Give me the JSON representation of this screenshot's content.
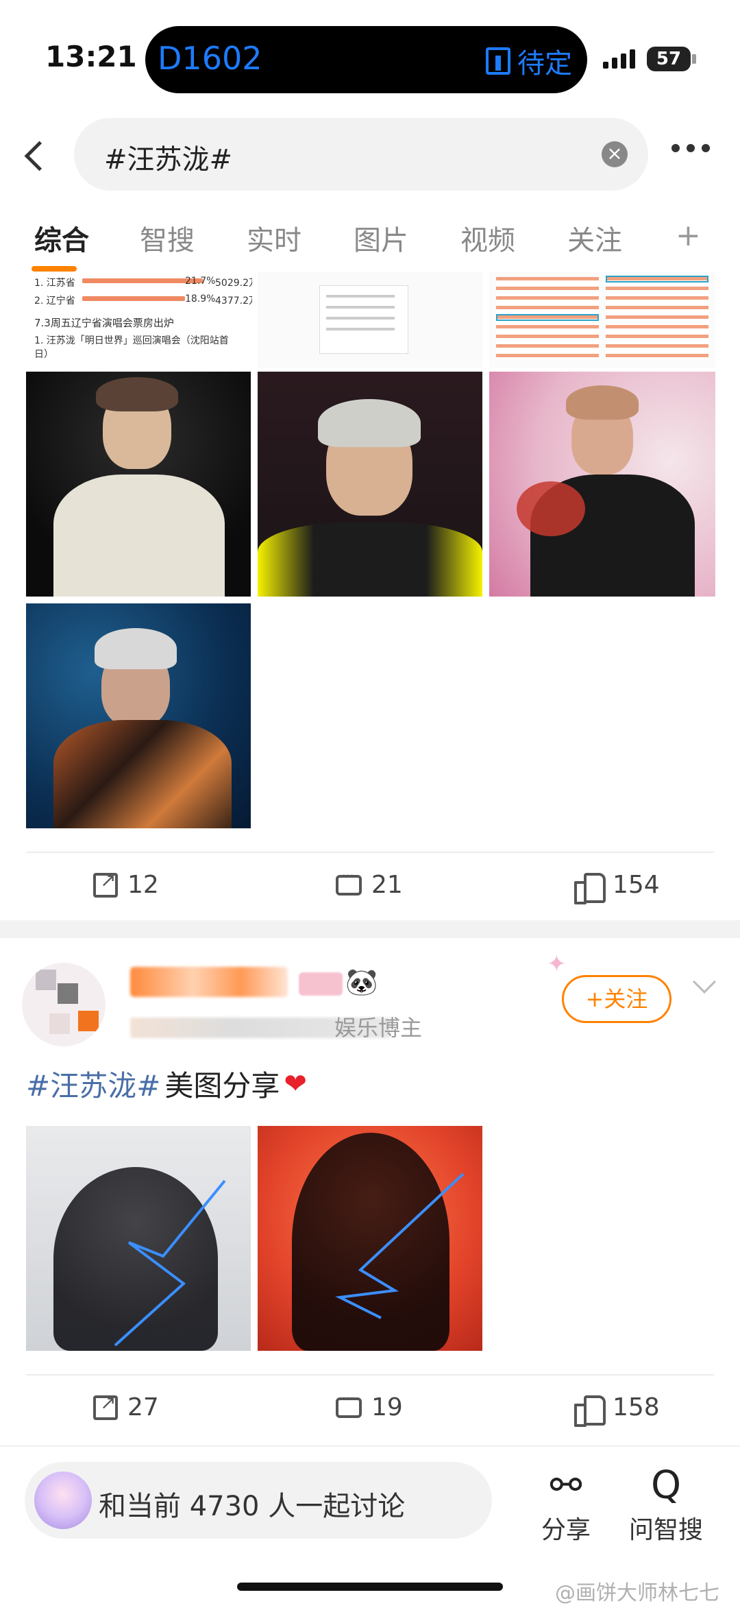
{
  "status_bar": {
    "time": "13:21",
    "island_label": "D1602",
    "island_status": "待定",
    "battery": "57"
  },
  "search": {
    "query": "#汪苏泷#"
  },
  "tabs": [
    "综合",
    "智搜",
    "实时",
    "图片",
    "视频",
    "关注"
  ],
  "tab_add": "+",
  "card1": {
    "doc_thumb": {
      "rows": [
        {
          "rank": "1. 江苏省",
          "pct": "21.7%",
          "amount": "5029.2万"
        },
        {
          "rank": "2. 辽宁省",
          "pct": "18.9%",
          "amount": "4377.2万"
        }
      ],
      "heading": "7.3周五辽宁省演唱会票房出炉",
      "item": "1. 汪苏泷「明日世界」巡回演唱会（沈阳站首日）"
    },
    "actions": {
      "reposts": "12",
      "comments": "21",
      "likes": "154"
    }
  },
  "card2": {
    "meta_text": "娱乐博主",
    "follow_label": "+关注",
    "post_hashtag": "#汪苏泷#",
    "post_text": "美图分享",
    "actions": {
      "reposts": "27",
      "comments": "19",
      "likes": "158"
    }
  },
  "bottom_bar": {
    "discuss_text": "和当前 4730 人一起讨论",
    "share_label": "分享",
    "ask_label": "问智搜"
  },
  "watermark": "@画饼大师林七七",
  "colors": {
    "accent": "#ff8200",
    "hashtag": "#4a6ea7",
    "island_text": "#1e7bff"
  }
}
